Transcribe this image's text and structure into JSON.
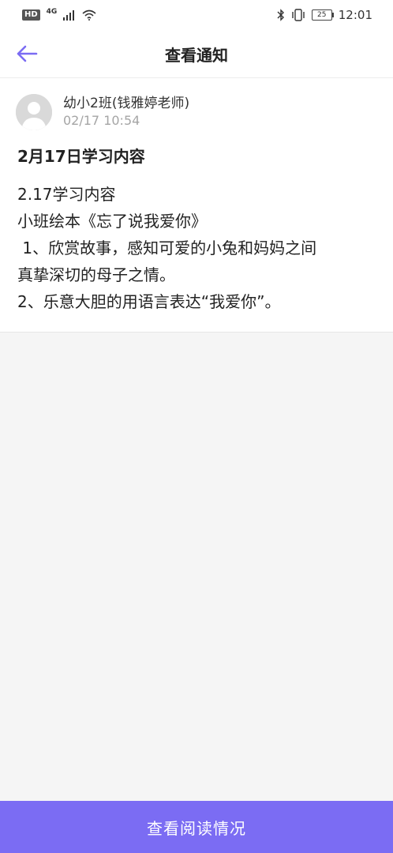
{
  "status_bar": {
    "hd": "HD",
    "network": "4G",
    "battery": "25",
    "time": "12:01"
  },
  "header": {
    "title": "查看通知"
  },
  "notice": {
    "author": "幼小2班(钱雅婷老师)",
    "time": "02/17 10:54",
    "title": "2月17日学习内容",
    "lines": [
      "2.17学习内容",
      "小班绘本《忘了说我爱你》",
      " 1、欣赏故事，感知可爱的小兔和妈妈之间",
      "真挚深切的母子之情。",
      "2、乐意大胆的用语言表达“我爱你”。"
    ]
  },
  "footer": {
    "button_label": "查看阅读情况"
  },
  "colors": {
    "accent": "#7b6cf3",
    "muted_text": "#a5a5a5"
  }
}
